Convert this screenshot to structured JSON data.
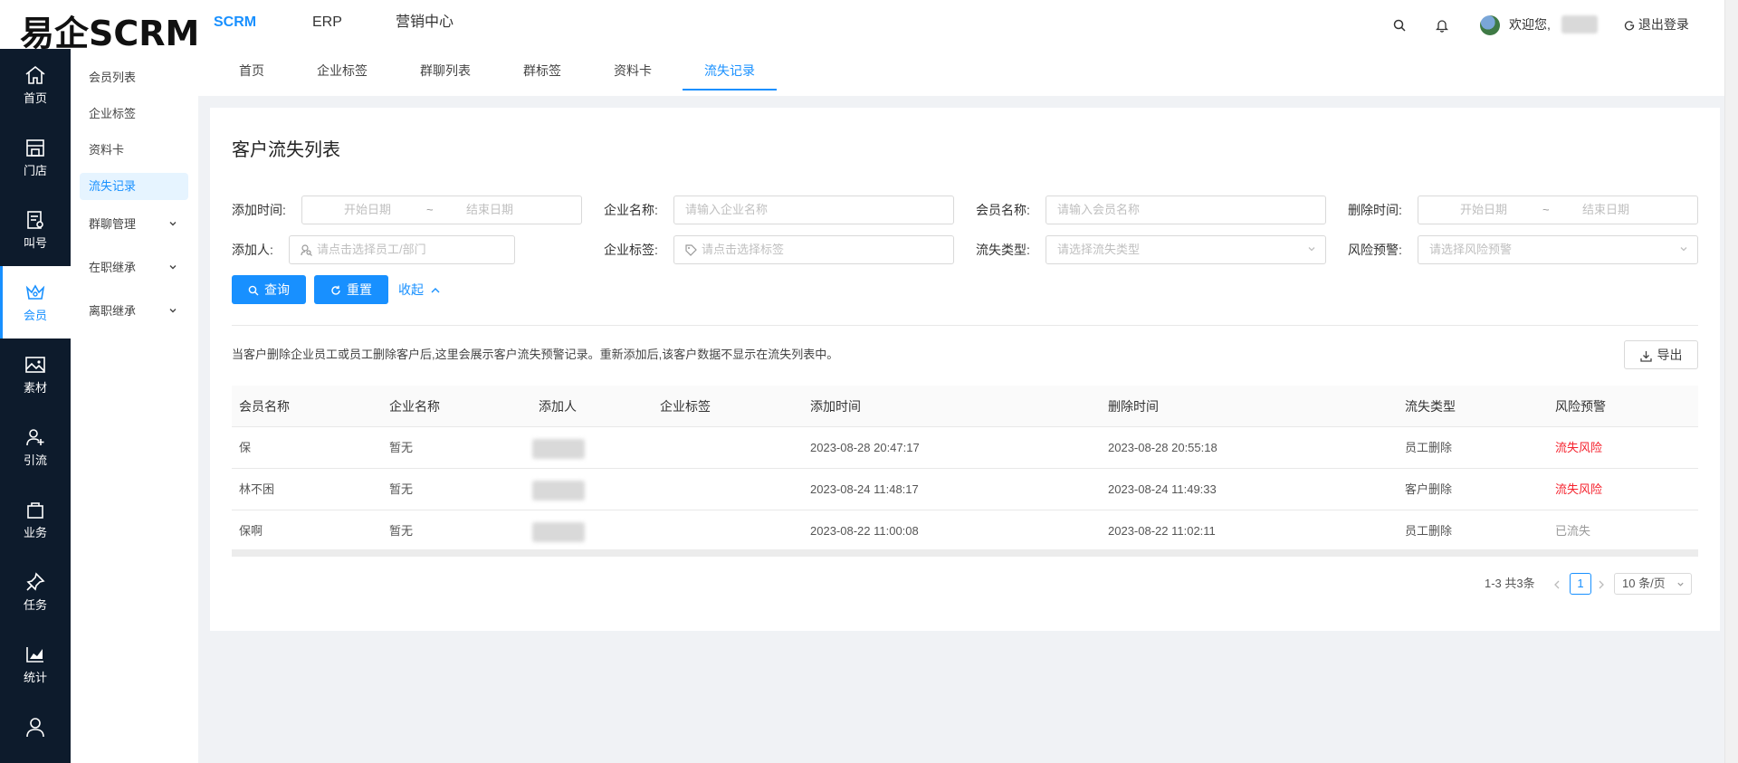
{
  "header": {
    "logo": "易企SCRM",
    "nav": [
      "SCRM",
      "ERP",
      "营销中心"
    ],
    "welcome": "欢迎您,",
    "logout": "退出登录"
  },
  "sidebar": {
    "items": [
      {
        "label": "首页",
        "icon": "home-icon"
      },
      {
        "label": "门店",
        "icon": "store-icon"
      },
      {
        "label": "叫号",
        "icon": "queue-icon"
      },
      {
        "label": "会员",
        "icon": "crown-icon"
      },
      {
        "label": "素材",
        "icon": "image-icon"
      },
      {
        "label": "引流",
        "icon": "user-add-icon"
      },
      {
        "label": "业务",
        "icon": "bag-icon"
      },
      {
        "label": "任务",
        "icon": "pin-icon"
      },
      {
        "label": "统计",
        "icon": "chart-icon"
      }
    ]
  },
  "submenu": {
    "items": [
      "会员列表",
      "企业标签",
      "资料卡",
      "流失记录",
      "群聊管理",
      "在职继承",
      "离职继承"
    ]
  },
  "tabs": [
    "首页",
    "企业标签",
    "群聊列表",
    "群标签",
    "资料卡",
    "流失记录"
  ],
  "page": {
    "title": "客户流失列表",
    "filters": {
      "add_time_label": "添加时间:",
      "start_placeholder": "开始日期",
      "range_sep": "~",
      "end_placeholder": "结束日期",
      "company_name_label": "企业名称:",
      "company_name_placeholder": "请输入企业名称",
      "member_name_label": "会员名称:",
      "member_name_placeholder": "请输入会员名称",
      "delete_time_label": "删除时间:",
      "adder_label": "添加人:",
      "adder_placeholder": "请点击选择员工/部门",
      "company_tag_label": "企业标签:",
      "company_tag_placeholder": "请点击选择标签",
      "loss_type_label": "流失类型:",
      "loss_type_placeholder": "请选择流失类型",
      "risk_label": "风险预警:",
      "risk_placeholder": "请选择风险预警"
    },
    "buttons": {
      "query": "查询",
      "reset": "重置",
      "collapse": "收起",
      "export": "导出"
    },
    "notice": "当客户删除企业员工或员工删除客户后,这里会展示客户流失预警记录。重新添加后,该客户数据不显示在流失列表中。",
    "table": {
      "columns": [
        "会员名称",
        "企业名称",
        "添加人",
        "企业标签",
        "添加时间",
        "删除时间",
        "流失类型",
        "风险预警"
      ],
      "rows": [
        {
          "member": "保",
          "company": "暂无",
          "tag": "",
          "added": "2023-08-28 20:47:17",
          "deleted": "2023-08-28 20:55:18",
          "type": "员工删除",
          "risk": "流失风险"
        },
        {
          "member": "林不困",
          "company": "暂无",
          "tag": "",
          "added": "2023-08-24 11:48:17",
          "deleted": "2023-08-24 11:49:33",
          "type": "客户删除",
          "risk": "流失风险"
        },
        {
          "member": "保啊",
          "company": "暂无",
          "tag": "",
          "added": "2023-08-22 11:00:08",
          "deleted": "2023-08-22 11:02:11",
          "type": "员工删除",
          "risk": "已流失"
        }
      ]
    },
    "pagination": {
      "summary": "1-3 共3条",
      "current": "1",
      "page_size": "10 条/页"
    }
  },
  "colors": {
    "accent": "#1890ff",
    "sidebar_bg": "#0d1b2c",
    "risk": "#f5222d"
  }
}
